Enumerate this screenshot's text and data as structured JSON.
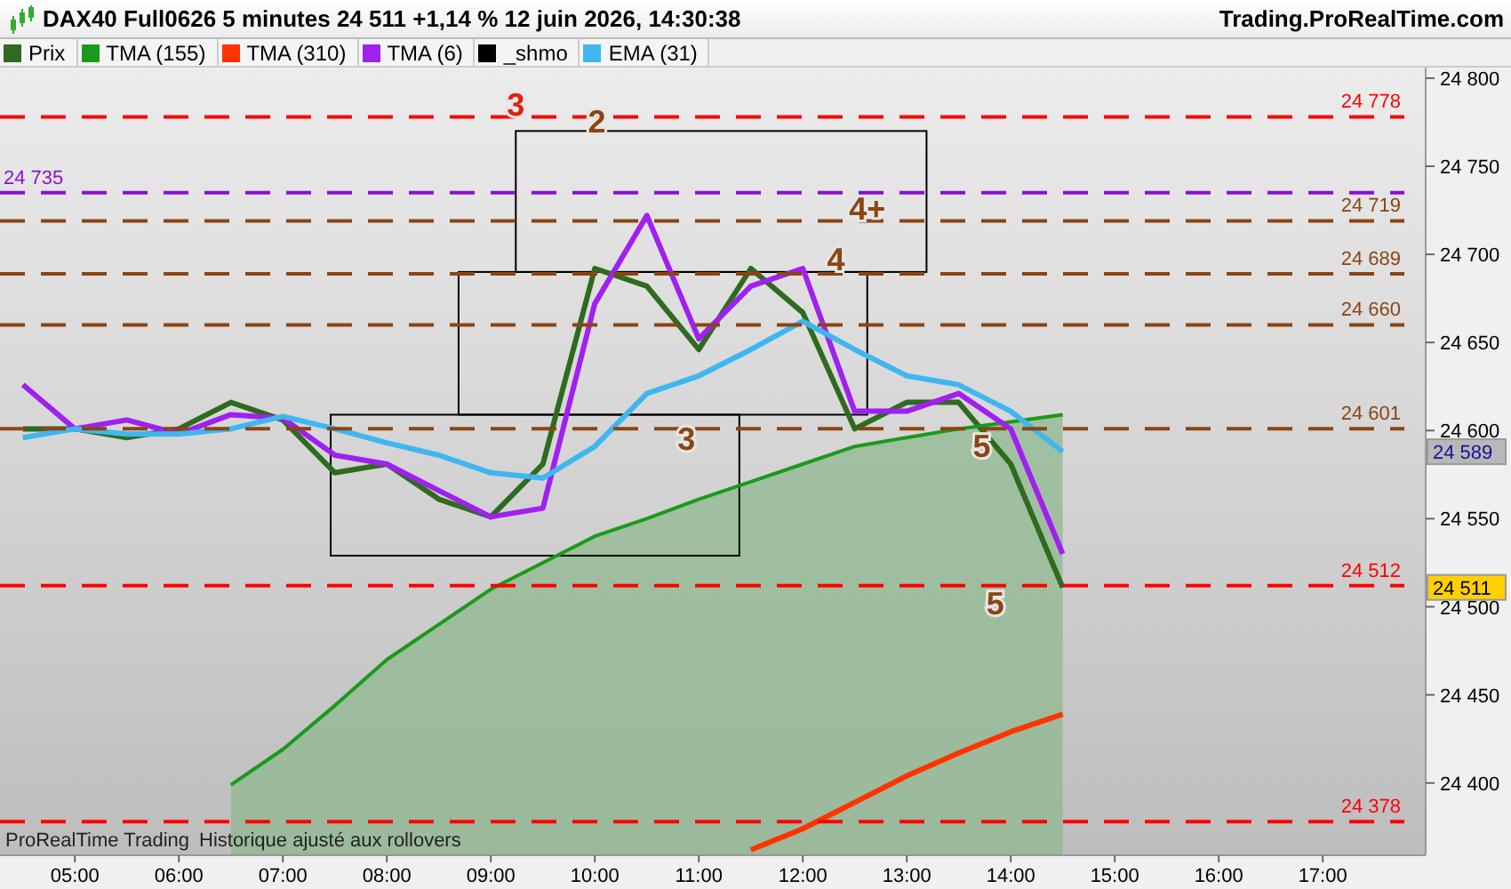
{
  "header": {
    "title": "DAX40 Full0626 5 minutes 24 511 +1,14 % 12 juin 2026, 14:30:38",
    "site": "Trading.ProRealTime.com"
  },
  "chart": {
    "footer": [
      "ProRealTime Trading",
      "Historique ajusté aux rollovers"
    ],
    "price_tags": [
      {
        "label": "24 589",
        "color": "#b8b8b8"
      },
      {
        "label": "24 511",
        "color": "#ffd000"
      }
    ],
    "chart_data": {
      "type": "line",
      "xlim": [
        4.28,
        17.99
      ],
      "ylim": [
        24359,
        24806
      ],
      "x": [
        4.5,
        5,
        5.5,
        6,
        6.5,
        7,
        7.5,
        8,
        8.5,
        9,
        9.5,
        10,
        10.5,
        11,
        11.5,
        12,
        12.5,
        13,
        13.5,
        14,
        14.5
      ],
      "series": [
        {
          "name": "Prix",
          "color": "#2e6b1e",
          "values": [
            24601,
            24601,
            24596,
            24601,
            24616,
            24606,
            24576,
            24581,
            24561,
            24551,
            24581,
            24692,
            24682,
            24646,
            24692,
            24667,
            24601,
            24616,
            24616,
            24581,
            24511
          ]
        },
        {
          "name": "TMA (155)",
          "color": "#1a9a1a",
          "values": [
            null,
            null,
            null,
            null,
            24399,
            24419,
            24444,
            24470,
            24490,
            24510,
            24525,
            24540,
            24550,
            24561,
            24571,
            24581,
            24591,
            24596,
            24601,
            24605,
            24609
          ]
        },
        {
          "name": "TMA (310)",
          "color": "#ff3300",
          "values": [
            null,
            null,
            null,
            null,
            null,
            null,
            null,
            null,
            null,
            null,
            null,
            null,
            null,
            null,
            24362,
            24374,
            24389,
            24404,
            24417,
            24429,
            24439
          ]
        },
        {
          "name": "TMA (6)",
          "color": "#a020f0",
          "values": [
            24626,
            24601,
            24606,
            24598,
            24609,
            24607,
            24586,
            24581,
            24566,
            24551,
            24556,
            24672,
            24722,
            24652,
            24682,
            24692,
            24611,
            24611,
            24621,
            24601,
            24530
          ]
        },
        {
          "name": "_shmo",
          "color": "#000000",
          "values": [
            null,
            null,
            null,
            null,
            null,
            null,
            null,
            null,
            null,
            null,
            null,
            null,
            null,
            null,
            null,
            null,
            null,
            null,
            null,
            null,
            null
          ]
        },
        {
          "name": "EMA (31)",
          "color": "#3fb6f0",
          "values": [
            24596,
            24601,
            24598,
            24598,
            24601,
            24608,
            24601,
            24593,
            24586,
            24576,
            24573,
            24591,
            24621,
            24631,
            24646,
            24662,
            24646,
            24631,
            24626,
            24611,
            24588
          ]
        }
      ],
      "xticks": [
        {
          "value": 5,
          "label": "05:00"
        },
        {
          "value": 6,
          "label": "06:00"
        },
        {
          "value": 7,
          "label": "07:00"
        },
        {
          "value": 8,
          "label": "08:00"
        },
        {
          "value": 9,
          "label": "09:00"
        },
        {
          "value": 10,
          "label": "10:00"
        },
        {
          "value": 11,
          "label": "11:00"
        },
        {
          "value": 12,
          "label": "12:00"
        },
        {
          "value": 13,
          "label": "13:00"
        },
        {
          "value": 14,
          "label": "14:00"
        },
        {
          "value": 15,
          "label": "15:00"
        },
        {
          "value": 16,
          "label": "16:00"
        },
        {
          "value": 17,
          "label": "17:00"
        }
      ],
      "yticks": [
        {
          "value": 24400,
          "label": "24 400"
        },
        {
          "value": 24450,
          "label": "24 450"
        },
        {
          "value": 24500,
          "label": "24 500"
        },
        {
          "value": 24550,
          "label": "24 550"
        },
        {
          "value": 24600,
          "label": "24 600"
        },
        {
          "value": 24650,
          "label": "24 650"
        },
        {
          "value": 24700,
          "label": "24 700"
        },
        {
          "value": 24750,
          "label": "24 750"
        },
        {
          "value": 24800,
          "label": "24 800"
        }
      ],
      "ref_lines": [
        {
          "axis": "y",
          "value": 24778,
          "color": "#ff0000",
          "label": "24 778"
        },
        {
          "axis": "y",
          "value": 24735,
          "color": "#8a10d0",
          "label": "24 735"
        },
        {
          "axis": "y",
          "value": 24719,
          "color": "#8b4513",
          "label": "24 719"
        },
        {
          "axis": "y",
          "value": 24689,
          "color": "#8b4513",
          "label": "24 689"
        },
        {
          "axis": "y",
          "value": 24660,
          "color": "#8b4513",
          "label": "24 660"
        },
        {
          "axis": "y",
          "value": 24601,
          "color": "#8b4513",
          "label": "24 601"
        },
        {
          "axis": "y",
          "value": 24512,
          "color": "#ff0000",
          "label": "24 512"
        },
        {
          "axis": "y",
          "value": 24378,
          "color": "#ff0000",
          "label": "24 378"
        }
      ],
      "annotations": [
        "3",
        "2",
        "4+",
        "4",
        "3",
        "5",
        "5"
      ]
    }
  }
}
